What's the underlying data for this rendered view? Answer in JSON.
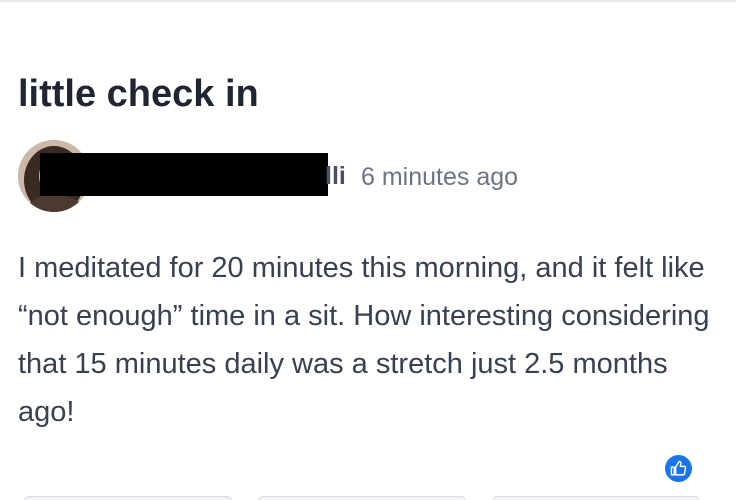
{
  "post": {
    "title": "little check in",
    "author": {
      "name_visible_fragment": "lli",
      "name_redacted": true
    },
    "timestamp": "6 minutes ago",
    "body": "I meditated for 20 minutes this morning, and it felt like “not enough” time in a sit. How interesting considering that 15 minutes daily was a stretch just 2.5 months ago!"
  },
  "actions": {
    "like_icon": "thumbs-up-icon"
  },
  "colors": {
    "title": "#1f2632",
    "body": "#374151",
    "meta": "#6b7585",
    "accent": "#1a73e8",
    "redaction": "#000000"
  }
}
